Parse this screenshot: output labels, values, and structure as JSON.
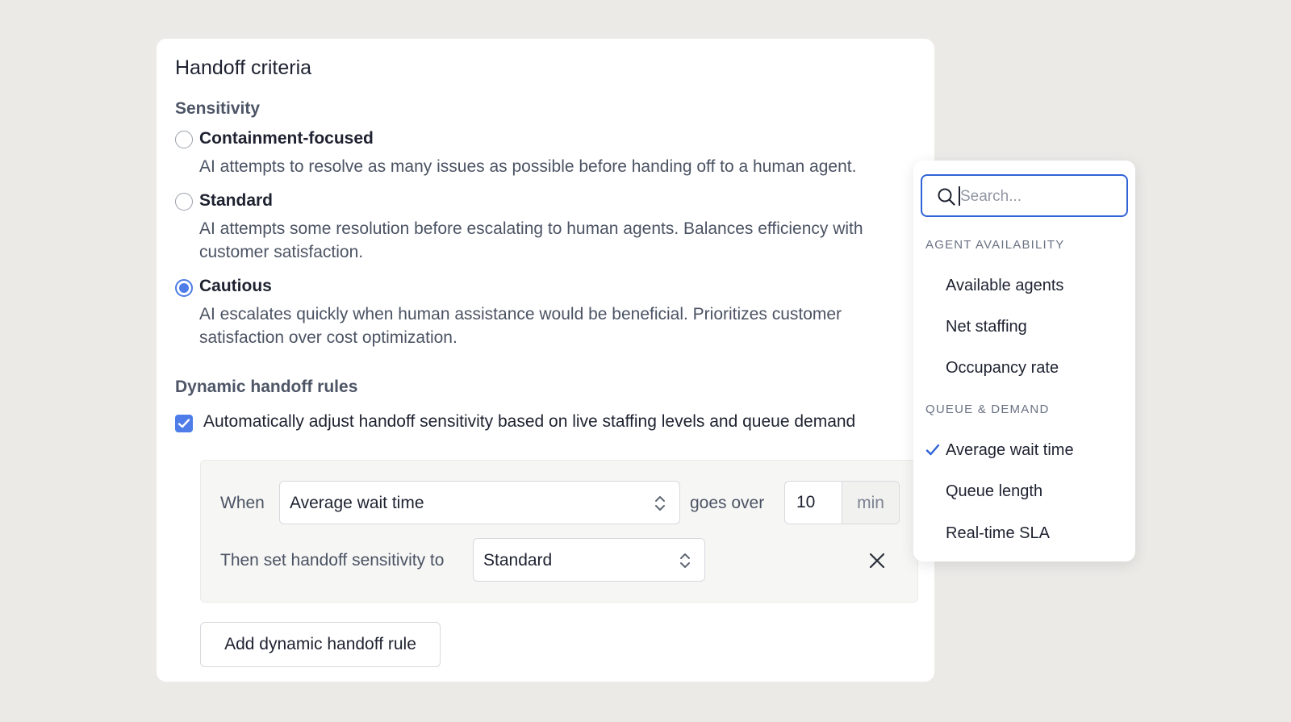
{
  "card": {
    "title": "Handoff criteria",
    "sensitivity_label": "Sensitivity",
    "options": [
      {
        "title": "Containment-focused",
        "description": "AI attempts to resolve as many issues as possible before handing off to a human agent.",
        "selected": false
      },
      {
        "title": "Standard",
        "description": "AI attempts some resolution before escalating to human agents. Balances efficiency with\ncustomer satisfaction.",
        "selected": false
      },
      {
        "title": "Cautious",
        "description": "AI escalates quickly when human assistance would be beneficial. Prioritizes customer\nsatisfaction over cost optimization.",
        "selected": true
      }
    ],
    "dynamic_label": "Dynamic handoff rules",
    "auto_adjust": {
      "label": "Automatically adjust handoff sensitivity based on live staffing levels and queue demand",
      "checked": true
    },
    "rule": {
      "when_label": "When",
      "metric": "Average wait time",
      "goes_over_label": "goes over",
      "threshold": "10",
      "unit": "min",
      "then_label": "Then set handoff sensitivity to",
      "sensitivity": "Standard"
    },
    "add_rule_label": "Add dynamic handoff rule"
  },
  "dropdown": {
    "search_placeholder": "Search...",
    "groups": [
      {
        "label": "AGENT AVAILABILITY",
        "items": [
          "Available agents",
          "Net staffing",
          "Occupancy rate"
        ]
      },
      {
        "label": "QUEUE & DEMAND",
        "items": [
          "Average wait time",
          "Queue length",
          "Real-time SLA"
        ]
      }
    ],
    "selected_item": "Average wait time"
  },
  "colors": {
    "accent": "#4e7ce8",
    "search_border": "#2f63d6",
    "background": "#ebeae7"
  }
}
